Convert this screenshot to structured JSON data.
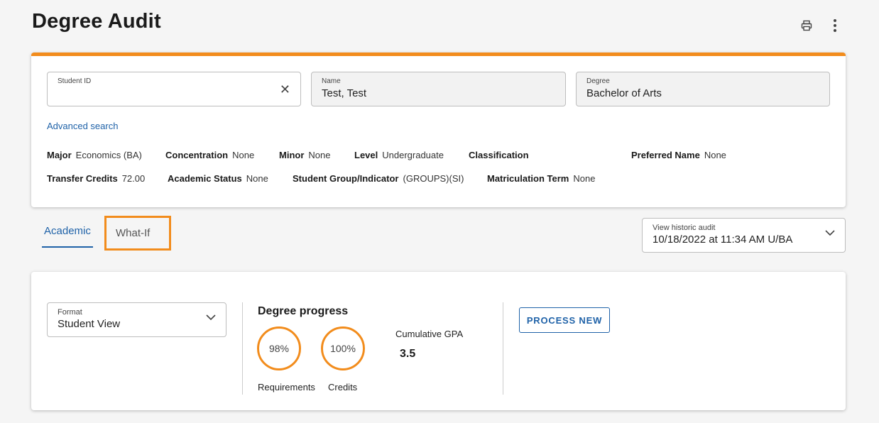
{
  "page": {
    "title": "Degree Audit"
  },
  "toolbar": {
    "print_icon": "print-icon",
    "more_icon": "more-vertical-icon"
  },
  "student": {
    "id_field": {
      "label": "Student ID",
      "value": ""
    },
    "name_field": {
      "label": "Name",
      "value": "Test, Test"
    },
    "degree_field": {
      "label": "Degree",
      "value": "Bachelor of Arts"
    },
    "advanced_search": "Advanced search",
    "row1": [
      {
        "label": "Major",
        "value": "Economics (BA)"
      },
      {
        "label": "Concentration",
        "value": "None"
      },
      {
        "label": "Minor",
        "value": "None"
      },
      {
        "label": "Level",
        "value": "Undergraduate"
      },
      {
        "label": "Classification",
        "value": ""
      },
      {
        "label": "Preferred Name",
        "value": "None"
      }
    ],
    "row2": [
      {
        "label": "Transfer Credits",
        "value": "72.00"
      },
      {
        "label": "Academic Status",
        "value": "None"
      },
      {
        "label": "Student Group/Indicator",
        "value": "(GROUPS)(SI)"
      },
      {
        "label": "Matriculation Term",
        "value": "None"
      }
    ]
  },
  "tabs": [
    {
      "label": "Academic",
      "active": true
    },
    {
      "label": "What-If",
      "active": false
    }
  ],
  "historic": {
    "label": "View historic audit",
    "value": "10/18/2022 at 11:34 AM U/BA"
  },
  "format": {
    "label": "Format",
    "value": "Student View"
  },
  "progress": {
    "title": "Degree progress",
    "requirements": {
      "percent": "98%",
      "label": "Requirements"
    },
    "credits": {
      "percent": "100%",
      "label": "Credits"
    },
    "gpa_label": "Cumulative GPA",
    "gpa_value": "3.5"
  },
  "process_button": "PROCESS NEW",
  "colors": {
    "accent": "#f28c1c",
    "link": "#1f62a8"
  }
}
